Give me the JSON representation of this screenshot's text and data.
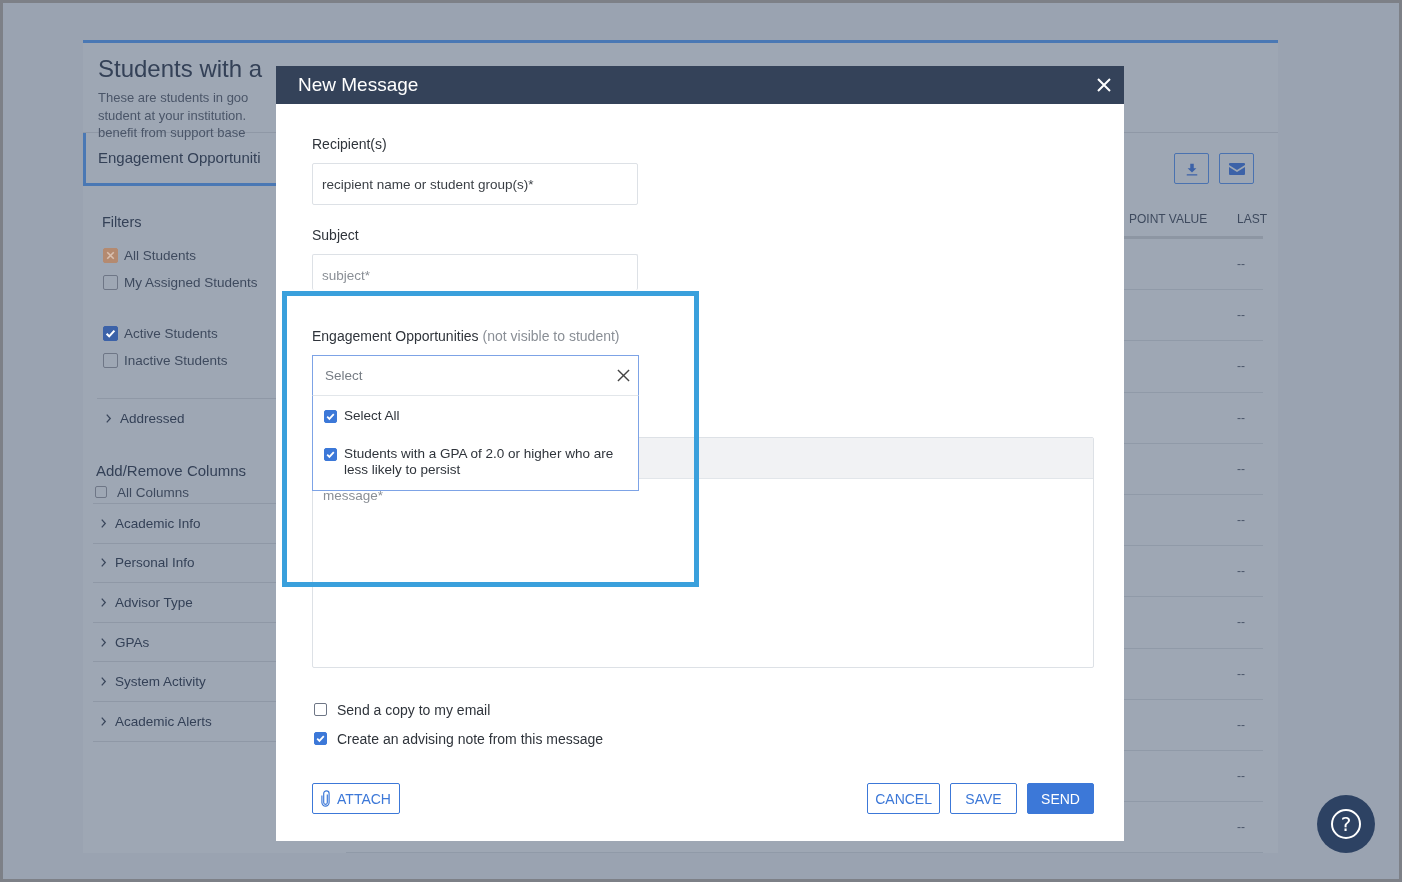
{
  "page": {
    "title": "Students with a",
    "description_lines": [
      "These are students in goo",
      "student at your institution.",
      "benefit from support base"
    ],
    "tab": "Engagement Opportuniti"
  },
  "sidebar": {
    "filters_heading": "Filters",
    "filter_groups": [
      {
        "items": [
          {
            "label": "All Students",
            "checked": true,
            "kind": "exclude"
          },
          {
            "label": "My Assigned Students",
            "checked": false,
            "kind": "exclude"
          }
        ]
      },
      {
        "items": [
          {
            "label": "Active Students",
            "checked": true,
            "kind": "include"
          },
          {
            "label": "Inactive Students",
            "checked": false,
            "kind": "include"
          }
        ]
      }
    ],
    "addressed": {
      "label": "Addressed",
      "expanded": false
    },
    "columns_heading": "Add/Remove Columns",
    "all_columns": {
      "label": "All Columns",
      "checked": false
    },
    "column_groups": [
      {
        "label": "Academic Info",
        "expanded": false
      },
      {
        "label": "Personal Info",
        "expanded": false
      },
      {
        "label": "Advisor Type",
        "expanded": false
      },
      {
        "label": "GPAs",
        "expanded": false
      },
      {
        "label": "System Activity",
        "expanded": false
      },
      {
        "label": "Academic Alerts",
        "expanded": false
      }
    ]
  },
  "table": {
    "columns": [
      "POINT VALUE",
      "LAST"
    ],
    "rows": [
      {
        "column_2": "--"
      },
      {
        "column_2": "--"
      },
      {
        "column_2": "--"
      },
      {
        "column_2": "--"
      },
      {
        "column_2": "--"
      },
      {
        "column_2": "--"
      },
      {
        "column_2": "--"
      },
      {
        "column_2": "--"
      },
      {
        "column_2": "--"
      },
      {
        "column_2": "--"
      },
      {
        "column_2": "--"
      },
      {
        "column_2": "--"
      }
    ]
  },
  "dialog": {
    "title": "New Message",
    "recipients": {
      "label": "Recipient(s)",
      "placeholder": "recipient name or student group(s)*"
    },
    "subject": {
      "label": "Subject",
      "placeholder": "subject*"
    },
    "engagement": {
      "label": "Engagement Opportunities",
      "hint": "(not visible to student)",
      "placeholder": "Select",
      "options": [
        {
          "label": "Select All",
          "checked": true
        },
        {
          "label": "Students with a GPA of 2.0 or higher who are less likely to persist",
          "checked": true
        }
      ]
    },
    "message": {
      "placeholder": "message*"
    },
    "options": [
      {
        "label": "Send a copy to my email",
        "checked": false
      },
      {
        "label": "Create an advising note from this message",
        "checked": true
      }
    ],
    "left_buttons": [
      {
        "label": "ATTACH",
        "kind": "attach"
      }
    ],
    "right_buttons": [
      {
        "label": "CANCEL",
        "kind": "outline"
      },
      {
        "label": "SAVE",
        "kind": "outline"
      },
      {
        "label": "SEND",
        "kind": "primary"
      }
    ]
  },
  "help": {
    "label": "?"
  }
}
